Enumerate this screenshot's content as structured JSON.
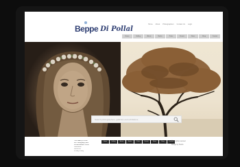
{
  "header": {
    "logo_main": "Beppe",
    "logo_script": "Di Pollal",
    "top_links": [
      "Home",
      "About",
      "Photographers",
      "Contact Us",
      "Login"
    ],
    "nav": [
      "Home",
      "Gallery",
      "Artists",
      "Books",
      "Prints",
      "Events",
      "News",
      "Shop",
      "Contact"
    ]
  },
  "search": {
    "placeholder": "Search photographers, galleries and exhibitions"
  },
  "footer": {
    "text_lines": [
      "The Gallery of Fine",
      "Art Photography and",
      "Limited Edition Prints",
      "",
      "Newsletter",
      "Follow us",
      "Privacy Policy"
    ],
    "nav": [
      "Home",
      "Gallery",
      "Artists",
      "Books",
      "Prints",
      "Events",
      "News",
      "Shop",
      "Contact"
    ],
    "right_lines": [
      "© All rights reserved",
      "Design by Studio"
    ]
  },
  "colors": {
    "logo": "#2e3e72",
    "nav_bg": "#cfcfcf",
    "footer_btn_bg": "#262626"
  }
}
